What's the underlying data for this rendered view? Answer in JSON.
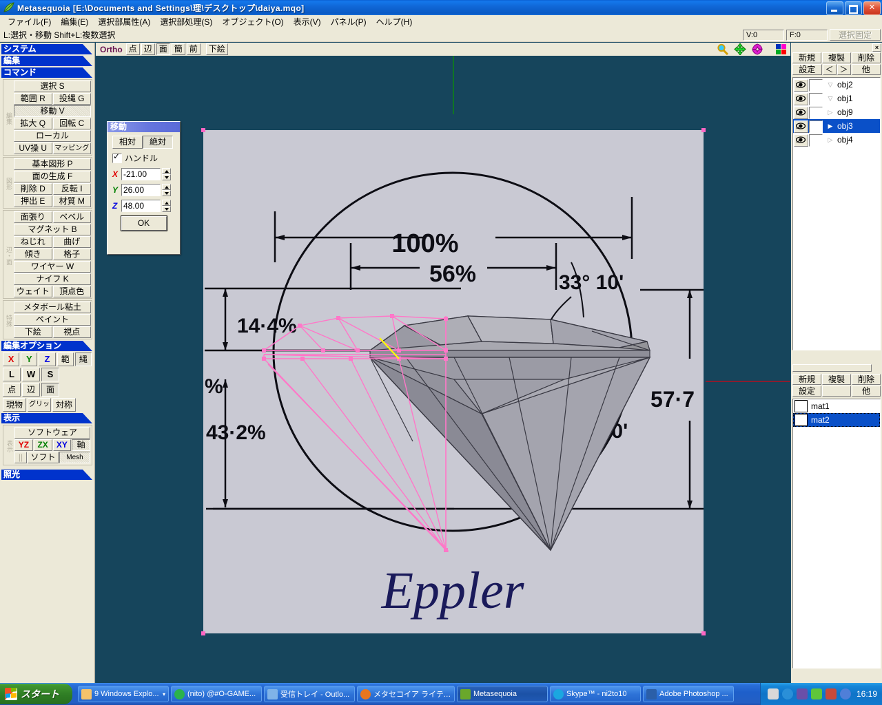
{
  "window": {
    "title": "Metasequoia [E:\\Documents and Settings\\理\\デスクトップ\\daiya.mqo]",
    "minimize": "_",
    "restore": "❐",
    "close": "✕"
  },
  "menubar": {
    "items": [
      "ファイル(F)",
      "編集(E)",
      "選択部属性(A)",
      "選択部処理(S)",
      "オブジェクト(O)",
      "表示(V)",
      "パネル(P)",
      "ヘルプ(H)"
    ]
  },
  "hintbar": {
    "text": "L:選択・移動  Shift+L:複数選択",
    "vertex_count": "V:0",
    "face_count": "F:0",
    "lock_label": "選択固定"
  },
  "sidebar": {
    "sections": [
      {
        "label": "システム"
      },
      {
        "label": "編集"
      },
      {
        "label": "コマンド"
      }
    ],
    "command_groups": [
      {
        "tab": "編集",
        "rows": [
          [
            {
              "label": "選択 S",
              "active": false
            }
          ],
          [
            {
              "label": "範囲 R",
              "active": false
            },
            {
              "label": "投縄 G",
              "active": false
            }
          ],
          [
            {
              "label": "移動 V",
              "active": true
            }
          ],
          [
            {
              "label": "拡大 Q",
              "active": false
            },
            {
              "label": "回転 C",
              "active": false
            }
          ],
          [
            {
              "label": "ローカル",
              "active": false
            }
          ],
          [
            {
              "label": "UV操 U",
              "active": false
            },
            {
              "label": "マッピング",
              "active": false,
              "small": true
            }
          ]
        ]
      },
      {
        "tab": "図形",
        "rows": [
          [
            {
              "label": "基本図形 P",
              "active": false
            }
          ],
          [
            {
              "label": "面の生成 F",
              "active": false
            }
          ],
          [
            {
              "label": "削除 D",
              "active": false
            },
            {
              "label": "反転 I",
              "active": false
            }
          ],
          [
            {
              "label": "押出 E",
              "active": false
            },
            {
              "label": "材質 M",
              "active": false
            }
          ]
        ]
      },
      {
        "tab": "辺・面",
        "rows": [
          [
            {
              "label": "面張り",
              "active": false
            },
            {
              "label": "ベベル",
              "active": false
            }
          ],
          [
            {
              "label": "マグネット B",
              "active": false
            }
          ],
          [
            {
              "label": "ねじれ",
              "active": false
            },
            {
              "label": "曲げ",
              "active": false
            }
          ],
          [
            {
              "label": "傾き",
              "active": false
            },
            {
              "label": "格子",
              "active": false
            }
          ],
          [
            {
              "label": "ワイヤー W",
              "active": false
            }
          ],
          [
            {
              "label": "ナイフ K",
              "active": false
            }
          ],
          [
            {
              "label": "ウェイト",
              "active": false
            },
            {
              "label": "頂点色",
              "active": false
            }
          ]
        ]
      },
      {
        "tab": "特殊",
        "rows": [
          [
            {
              "label": "メタボール粘土",
              "active": false
            }
          ],
          [
            {
              "label": "ペイント",
              "active": false
            }
          ],
          [
            {
              "label": "下絵",
              "active": false
            },
            {
              "label": "視点",
              "active": false
            }
          ]
        ]
      }
    ],
    "edit_options": {
      "label": "編集オプション",
      "row1": [
        {
          "label": "X",
          "color": "#e00000",
          "sunk": false
        },
        {
          "label": "Y",
          "color": "#008000",
          "sunk": false
        },
        {
          "label": "Z",
          "color": "#0000e0",
          "sunk": false
        },
        {
          "label": "範",
          "color": "#000000",
          "sunk": false
        },
        {
          "label": "縄",
          "color": "#000000",
          "sunk": true
        }
      ],
      "row2": [
        {
          "label": "L",
          "sunk": false
        },
        {
          "label": "W",
          "sunk": false
        },
        {
          "label": "S",
          "sunk": true
        }
      ],
      "row3": [
        {
          "label": "点",
          "sunk": false
        },
        {
          "label": "辺",
          "sunk": false
        },
        {
          "label": "面",
          "sunk": true
        }
      ],
      "row4": [
        {
          "label": "現物",
          "sunk": false
        },
        {
          "label": "グリッド",
          "sunk": false
        },
        {
          "label": "対称",
          "sunk": false
        }
      ]
    },
    "display": {
      "label": "表示",
      "tab": "表示",
      "row1": [
        {
          "label": "ソフトウェア",
          "sunk": false
        }
      ],
      "row2": [
        {
          "label": "YZ",
          "color": "#e00000",
          "sunk": false
        },
        {
          "label": "ZX",
          "color": "#008000",
          "sunk": false
        },
        {
          "label": "XY",
          "color": "#0000e0",
          "sunk": false
        },
        {
          "label": "軸",
          "color": "#000000",
          "sunk": true
        }
      ],
      "row3": [
        {
          "label": "||",
          "sunk": false,
          "dim": true
        },
        {
          "label": "ソフト",
          "sunk": false
        },
        {
          "label": "Mesh",
          "sunk": true,
          "small": true
        }
      ]
    },
    "lighting": {
      "label": "照光"
    }
  },
  "viewport": {
    "projection_label": "Ortho",
    "tabs": [
      {
        "label": "点",
        "sunk": false
      },
      {
        "label": "辺",
        "sunk": false
      },
      {
        "label": "面",
        "sunk": true
      },
      {
        "label": "簡",
        "sunk": false
      },
      {
        "label": "前",
        "sunk": false
      },
      {
        "label": "下絵",
        "sunk": false
      }
    ],
    "icons": [
      "zoom-icon",
      "pan-icon",
      "rotate-icon",
      "palette-icon"
    ],
    "background_image_text": {
      "width_100": "100%",
      "width_56": "56%",
      "crown_height": "14·4%",
      "pavilion_height": "43·2%",
      "girdle_pct": "%",
      "crown_angle": "33° 10'",
      "pavilion_angle": "40° 50'",
      "total_depth": "57·7",
      "signature": "Eppler"
    }
  },
  "move_dialog": {
    "title": "移動",
    "mode_relative": "相対",
    "mode_absolute": "絶対",
    "handle_label": "ハンドル",
    "handle_checked": true,
    "x_label": "X",
    "x_value": "-21.00",
    "y_label": "Y",
    "y_value": "26.00",
    "z_label": "Z",
    "z_value": "48.00",
    "ok_label": "OK"
  },
  "object_panel": {
    "close_label": "×",
    "buttons_row1": [
      "新規",
      "複製",
      "削除"
    ],
    "buttons_row2": [
      "設定",
      "＜",
      "＞",
      "他"
    ],
    "items": [
      {
        "name": "obj2",
        "expanded": true,
        "selected": false
      },
      {
        "name": "obj1",
        "expanded": true,
        "selected": false
      },
      {
        "name": "obj9",
        "expanded": false,
        "selected": false
      },
      {
        "name": "obj3",
        "expanded": false,
        "selected": true
      },
      {
        "name": "obj4",
        "expanded": false,
        "selected": false
      }
    ]
  },
  "material_panel": {
    "close_label": "×",
    "buttons_row1": [
      "新規",
      "複製",
      "削除"
    ],
    "buttons_row2": [
      "設定",
      "",
      "他"
    ],
    "items": [
      {
        "name": "mat1",
        "color": "#ffffff",
        "selected": false
      },
      {
        "name": "mat2",
        "color": "#ffffff",
        "selected": true
      }
    ]
  },
  "taskbar": {
    "start_label": "スタート",
    "tasks": [
      {
        "label": "9 Windows Explo...",
        "icon_color": "#f5c26b",
        "active": false,
        "has_arrow": true
      },
      {
        "label": "(nito) @#O-GAME...",
        "icon_color": "#2bb24c",
        "active": false,
        "has_arrow": false
      },
      {
        "label": "受信トレイ - Outlo...",
        "icon_color": "#7fb3e8",
        "active": false,
        "has_arrow": false
      },
      {
        "label": "メタセコイア ライティ...",
        "icon_color": "#e8761f",
        "active": false,
        "has_arrow": false
      },
      {
        "label": "Metasequoia",
        "icon_color": "#6aa82b",
        "active": true,
        "has_arrow": false
      },
      {
        "label": "Skype™ - ni2to10",
        "icon_color": "#1ba7e0",
        "active": false,
        "has_arrow": false
      },
      {
        "label": "Adobe Photoshop ...",
        "icon_color": "#2b5fa8",
        "active": false,
        "has_arrow": false
      }
    ],
    "tray_icons": [
      "keyboard-icon",
      "show-desktop-icon",
      "volume-icon",
      "shield-icon",
      "update-icon",
      "circle-icon"
    ],
    "clock": "16:19"
  },
  "colors": {
    "titlebar_blue": "#0a5fd0",
    "panel_bg": "#ece9d8",
    "viewport_bg": "#16455c",
    "selection_blue": "#0a50c8",
    "section_blue": "#0033cc",
    "ortho_purple": "#6a1552",
    "mesh_pink": "#ff77c8",
    "mesh_yellow": "#ffff00",
    "blueprint_bg": "#c8c8d2",
    "signature_navy": "#1a1a5a"
  }
}
